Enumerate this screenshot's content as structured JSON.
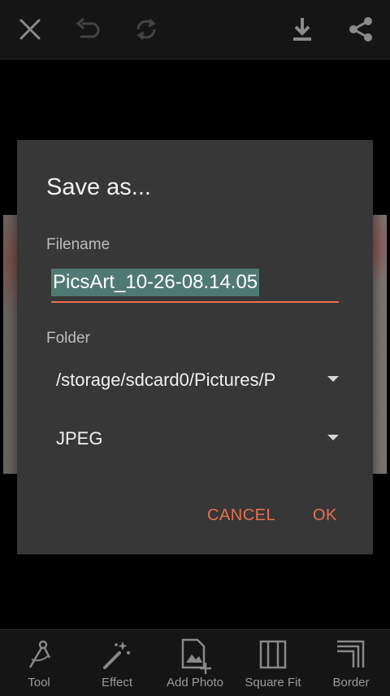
{
  "toolbar": {
    "close_icon": "close-icon",
    "undo_icon": "undo-icon",
    "redo_icon": "redo-icon",
    "download_icon": "download-icon",
    "share_icon": "share-icon"
  },
  "dialog": {
    "title": "Save as...",
    "filename_label": "Filename",
    "filename_value": "PicsArt_10-26-08.14.05",
    "folder_label": "Folder",
    "folder_value": "/storage/sdcard0/Pictures/P",
    "format_value": "JPEG",
    "cancel_label": "CANCEL",
    "ok_label": "OK"
  },
  "bottom_nav": [
    {
      "label": "Tool",
      "icon": "compass-icon"
    },
    {
      "label": "Effect",
      "icon": "magic-wand-icon"
    },
    {
      "label": "Add Photo",
      "icon": "add-photo-icon"
    },
    {
      "label": "Square Fit",
      "icon": "square-fit-icon"
    },
    {
      "label": "Border",
      "icon": "border-icon"
    }
  ],
  "colors": {
    "accent": "#e8704c",
    "selection": "#4f7a73",
    "dialog_bg": "#373737",
    "bar_bg": "#151515"
  }
}
